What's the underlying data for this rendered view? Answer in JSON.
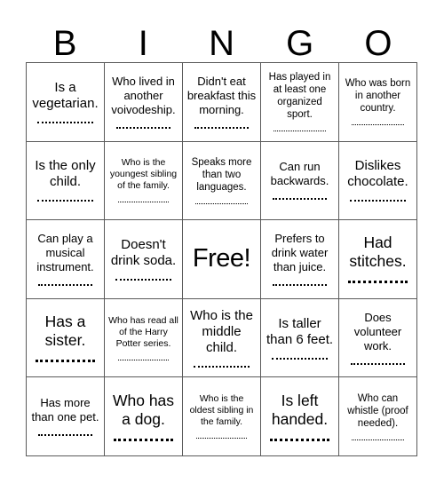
{
  "card": {
    "title": "BINGO",
    "header_letters": [
      "B",
      "I",
      "N",
      "G",
      "O"
    ],
    "grid_size": "5x5",
    "free_space_index": 12,
    "border_color": "#5a5a5a",
    "text_color": "#000000",
    "background_color": "#ffffff",
    "signature_line": "dotted"
  },
  "cells": [
    {
      "label": "Is a vegetarian.",
      "size": "lg",
      "has_signature_line": true
    },
    {
      "label": "Who lived in another voivodeship.",
      "size": "md",
      "has_signature_line": true
    },
    {
      "label": "Didn't eat breakfast this morning.",
      "size": "md",
      "has_signature_line": true
    },
    {
      "label": "Has played in at least one organized sport.",
      "size": "sm",
      "has_signature_line": true
    },
    {
      "label": "Who was born in another country.",
      "size": "sm",
      "has_signature_line": true
    },
    {
      "label": "Is the only child.",
      "size": "lg",
      "has_signature_line": true
    },
    {
      "label": "Who is the youngest sibling of the family.",
      "size": "xs",
      "has_signature_line": true
    },
    {
      "label": "Speaks more than two languages.",
      "size": "sm",
      "has_signature_line": true
    },
    {
      "label": "Can run backwards.",
      "size": "md",
      "has_signature_line": true
    },
    {
      "label": "Dislikes chocolate.",
      "size": "lg",
      "has_signature_line": true
    },
    {
      "label": "Can play a musical instrument.",
      "size": "md",
      "has_signature_line": true
    },
    {
      "label": "Doesn't drink soda.",
      "size": "lg",
      "has_signature_line": true
    },
    {
      "label": "Free!",
      "size": "free",
      "has_signature_line": false
    },
    {
      "label": "Prefers to drink water than juice.",
      "size": "md",
      "has_signature_line": true
    },
    {
      "label": "Had stitches.",
      "size": "xl",
      "has_signature_line": true
    },
    {
      "label": "Has a sister.",
      "size": "xl",
      "has_signature_line": true
    },
    {
      "label": "Who has read all of the Harry Potter series.",
      "size": "xs",
      "has_signature_line": true
    },
    {
      "label": "Who is the middle child.",
      "size": "lg",
      "has_signature_line": true
    },
    {
      "label": "Is taller than 6 feet.",
      "size": "lg",
      "has_signature_line": true
    },
    {
      "label": "Does volunteer work.",
      "size": "md",
      "has_signature_line": true
    },
    {
      "label": "Has more than one pet.",
      "size": "md",
      "has_signature_line": true
    },
    {
      "label": "Who has a dog.",
      "size": "xl",
      "has_signature_line": true
    },
    {
      "label": "Who is the oldest sibling in the family.",
      "size": "xs",
      "has_signature_line": true
    },
    {
      "label": "Is left handed.",
      "size": "xl",
      "has_signature_line": true
    },
    {
      "label": "Who can whistle (proof needed).",
      "size": "sm",
      "has_signature_line": true
    }
  ]
}
